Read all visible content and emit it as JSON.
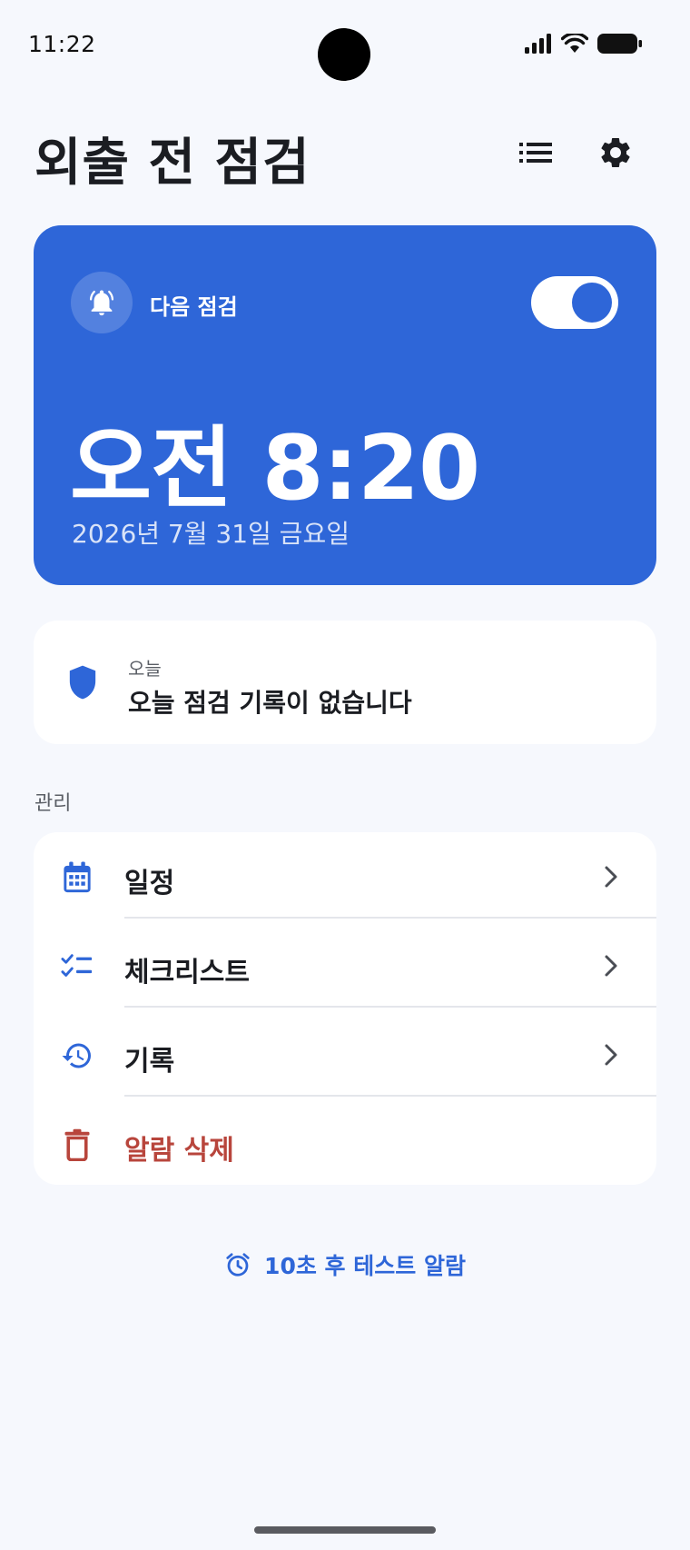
{
  "status_bar": {
    "time": "11:22"
  },
  "header": {
    "title": "외출 전 점검"
  },
  "alarm_card": {
    "label": "다음 점검",
    "enabled": true,
    "time": "오전 8:20",
    "date": "2026년 7월 31일 금요일"
  },
  "today_card": {
    "label": "오늘",
    "status": "오늘 점검 기록이 없습니다"
  },
  "manage": {
    "section_label": "관리",
    "items": [
      {
        "label": "일정",
        "icon": "calendar-icon"
      },
      {
        "label": "체크리스트",
        "icon": "checklist-icon"
      },
      {
        "label": "기록",
        "icon": "history-icon"
      },
      {
        "label": "알람 삭제",
        "icon": "trash-icon"
      }
    ]
  },
  "test_alarm": {
    "label": "10초 후 테스트 알람"
  },
  "colors": {
    "accent": "#2e66d8",
    "danger": "#b8453c",
    "background": "#f6f8fd"
  }
}
